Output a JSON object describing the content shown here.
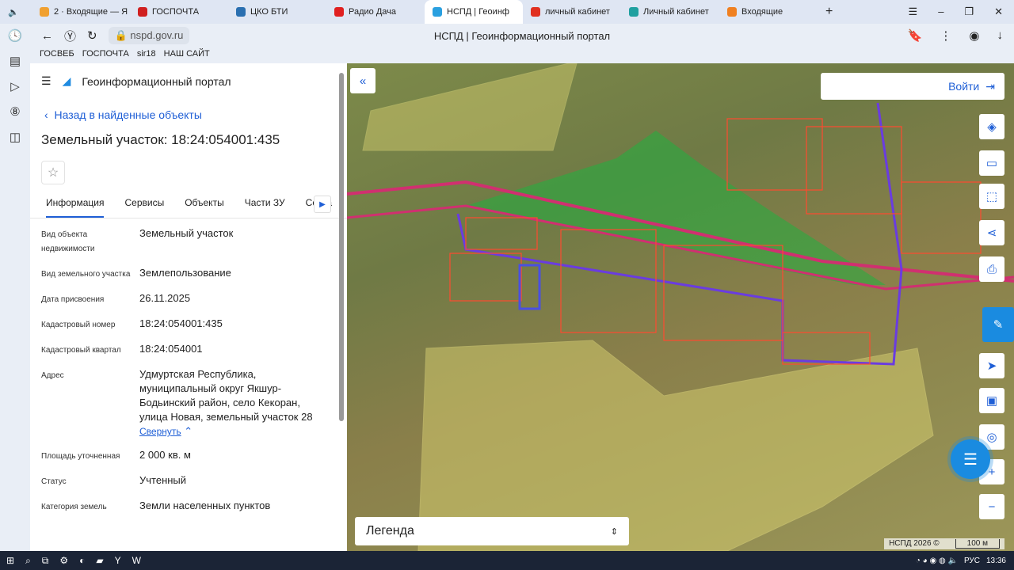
{
  "browser": {
    "tabs": [
      {
        "label": "2 · Входящие — Я",
        "color": "#f0a030"
      },
      {
        "label": "ГОСПОЧТА",
        "color": "#d02020"
      },
      {
        "label": "ЦКО БТИ",
        "color": "#2a6fb0"
      },
      {
        "label": "Радио Дача",
        "color": "#e02020"
      },
      {
        "label": "НСПД | Геоинф",
        "color": "#2aa0e0"
      },
      {
        "label": "личный кабинет",
        "color": "#e03020"
      },
      {
        "label": "Личный кабинет",
        "color": "#20a0a0"
      },
      {
        "label": "Входящие",
        "color": "#f08020"
      }
    ],
    "url": "nspd.gov.ru",
    "page_title": "НСПД | Геоинформационный портал",
    "bookmarks": [
      "ГОСВЕБ",
      "ГОСПОЧТА",
      "sir18",
      "НАШ САЙТ"
    ]
  },
  "panel": {
    "portal_name": "Геоинформационный портал",
    "back_link": "Назад в найденные объекты",
    "title": "Земельный участок: 18:24:054001:435",
    "tabs": [
      "Информация",
      "Сервисы",
      "Объекты",
      "Части ЗУ",
      "Соста"
    ],
    "rows": [
      {
        "k": "Вид объекта недвижимости",
        "v": "Земельный участок"
      },
      {
        "k": "Вид земельного участка",
        "v": "Землепользование"
      },
      {
        "k": "Дата присвоения",
        "v": "26.11.2025"
      },
      {
        "k": "Кадастровый номер",
        "v": "18:24:054001:435"
      },
      {
        "k": "Кадастровый квартал",
        "v": "18:24:054001"
      },
      {
        "k": "Адрес",
        "v": "Удмуртская Республика, муниципальный округ Якшур-Бодьинский район, село Кекоран, улица Новая, земельный участок 28"
      },
      {
        "k": "Площадь уточненная",
        "v": "2 000 кв. м"
      },
      {
        "k": "Статус",
        "v": "Учтенный"
      },
      {
        "k": "Категория земель",
        "v": "Земли населенных пунктов"
      }
    ],
    "collapse": "Свернуть"
  },
  "map": {
    "login": "Войти",
    "legend": "Легенда",
    "copyright": "НСПД 2026 ©",
    "scale": "100 м"
  },
  "taskbar": {
    "lang": "РУС",
    "time": "13:36"
  }
}
